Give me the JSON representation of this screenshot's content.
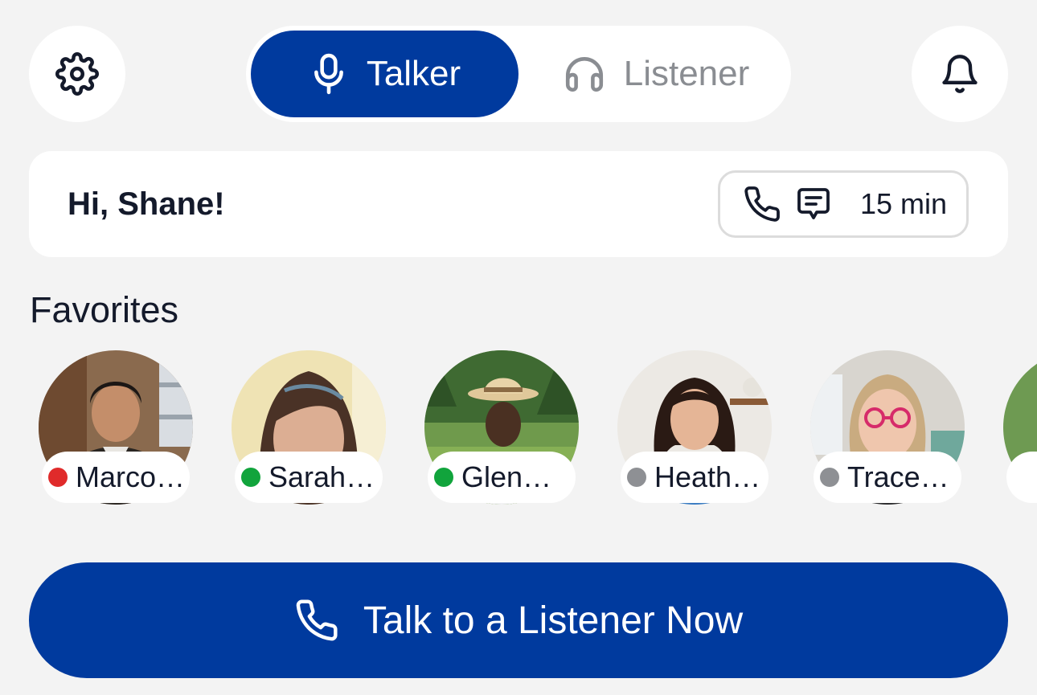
{
  "header": {
    "settings_icon": "gear-icon",
    "notifications_icon": "bell-icon",
    "mode_tabs": [
      {
        "label": "Talker",
        "icon": "microphone-icon",
        "active": true
      },
      {
        "label": "Listener",
        "icon": "headphones-icon",
        "active": false
      }
    ]
  },
  "greeting": {
    "text": "Hi, Shane!",
    "balance": {
      "icons": [
        "phone-icon",
        "chat-icon"
      ],
      "value": "15 min"
    }
  },
  "favorites": {
    "title": "Favorites",
    "items": [
      {
        "name": "Marco…",
        "status": "busy",
        "status_color": "#e02b2b"
      },
      {
        "name": "Sarah…",
        "status": "online",
        "status_color": "#11a43c"
      },
      {
        "name": "Glen…",
        "status": "online",
        "status_color": "#11a43c"
      },
      {
        "name": "Heath…",
        "status": "offline",
        "status_color": "#8e9094"
      },
      {
        "name": "Trace…",
        "status": "offline",
        "status_color": "#8e9094"
      }
    ]
  },
  "cta": {
    "label": "Talk to a Listener Now",
    "icon": "phone-icon"
  },
  "colors": {
    "primary": "#003a9e",
    "background": "#f3f3f3",
    "card": "#ffffff",
    "text": "#141a2b",
    "muted": "#8a8d92"
  }
}
